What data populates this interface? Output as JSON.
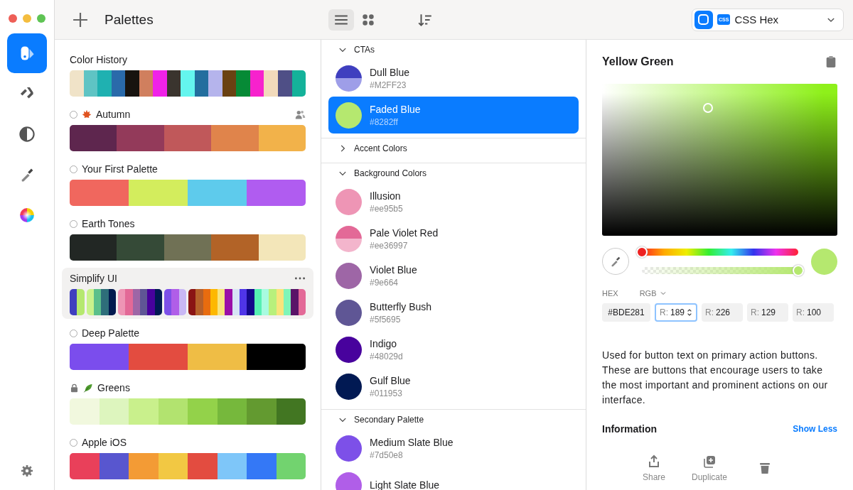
{
  "sidebar": {
    "items": [
      {
        "kind": "palettes",
        "selected": true
      },
      {
        "kind": "tools",
        "selected": false
      },
      {
        "kind": "contrast",
        "selected": false
      },
      {
        "kind": "picker",
        "selected": false
      },
      {
        "kind": "wheel",
        "selected": false
      }
    ]
  },
  "toolbar": {
    "title": "Palettes",
    "views": [
      {
        "kind": "list",
        "selected": true
      },
      {
        "kind": "grid",
        "selected": false
      }
    ],
    "format": {
      "badge": "CSS",
      "label": "CSS Hex"
    }
  },
  "palettes": [
    {
      "name": "Color History",
      "kind": "history",
      "selected": false,
      "shared": false,
      "groups": [
        [
          {
            "color": "#f0e3c8"
          },
          {
            "color": "#5fc4c4"
          },
          {
            "color": "#1fb1b1"
          },
          {
            "color": "#2a6aaa"
          },
          {
            "color": "#17130f"
          },
          {
            "color": "#d07f5e"
          },
          {
            "color": "#f022e8"
          },
          {
            "color": "#3a342e"
          },
          {
            "color": "#64f5ee"
          },
          {
            "color": "#236e9e"
          },
          {
            "color": "#b5b4ec"
          },
          {
            "color": "#6a4112"
          },
          {
            "color": "#068a36"
          },
          {
            "color": "#f722cd"
          },
          {
            "color": "#f2dabb"
          },
          {
            "color": "#4f4f86"
          },
          {
            "color": "#14b29a"
          }
        ]
      ]
    },
    {
      "name": "Autumn",
      "kind": "seasonal",
      "selected": false,
      "shared": true,
      "groups": [
        [
          {
            "color": "#5e264e"
          },
          {
            "color": "#933a5a"
          },
          {
            "color": "#c0585a"
          },
          {
            "color": "#e0844b"
          },
          {
            "color": "#f2b24a"
          }
        ]
      ]
    },
    {
      "name": "Your First Palette",
      "kind": "radio",
      "selected": false,
      "shared": false,
      "groups": [
        [
          {
            "color": "#f0675e"
          },
          {
            "color": "#d3ed5d"
          },
          {
            "color": "#5ecbec"
          },
          {
            "color": "#b05cf0"
          }
        ]
      ]
    },
    {
      "name": "Earth Tones",
      "kind": "radio",
      "selected": false,
      "shared": false,
      "groups": [
        [
          {
            "color": "#222724"
          },
          {
            "color": "#354a37"
          },
          {
            "color": "#707155"
          },
          {
            "color": "#b26327"
          },
          {
            "color": "#f3e6b9"
          }
        ]
      ]
    },
    {
      "name": "Simplify UI",
      "kind": "group",
      "selected": true,
      "shared": false,
      "groups": [
        [
          {
            "color": "#3f3fbf"
          },
          {
            "color": "#b5e86f"
          }
        ],
        [
          {
            "color": "#c9f28c"
          },
          {
            "color": "#5bbf8b"
          },
          {
            "color": "#2e6e7a"
          },
          {
            "color": "#031a4f"
          }
        ],
        [
          {
            "color": "#ee95b5"
          },
          {
            "color": "#e36997"
          },
          {
            "color": "#9e66a6"
          },
          {
            "color": "#5f5695"
          },
          {
            "color": "#48029d"
          },
          {
            "color": "#011953"
          }
        ],
        [
          {
            "color": "#7d50e8"
          },
          {
            "color": "#b05ee8"
          },
          {
            "color": "#c9b8f5"
          }
        ],
        [
          {
            "color": "#8a1414"
          },
          {
            "color": "#b5602a"
          },
          {
            "color": "#e86c0f"
          },
          {
            "color": "#fdb800"
          },
          {
            "color": "#f8e47c"
          },
          {
            "color": "#9a0fa8"
          },
          {
            "color": "#d6e4f5"
          },
          {
            "color": "#4f35e8"
          },
          {
            "color": "#14078a"
          },
          {
            "color": "#56f0b2"
          },
          {
            "color": "#a8fbe0"
          },
          {
            "color": "#b8f07c"
          },
          {
            "color": "#f8e47c"
          },
          {
            "color": "#7ff5b8"
          },
          {
            "color": "#5a1468"
          },
          {
            "color": "#e36997"
          }
        ]
      ]
    },
    {
      "name": "Deep Palette",
      "kind": "radio",
      "selected": false,
      "shared": false,
      "groups": [
        [
          {
            "color": "#7b4ded"
          },
          {
            "color": "#e34c40"
          },
          {
            "color": "#efbd45"
          },
          {
            "color": "#000000"
          }
        ]
      ]
    },
    {
      "name": "Greens",
      "kind": "locked",
      "selected": false,
      "shared": false,
      "groups": [
        [
          {
            "color": "#f1f8de"
          },
          {
            "color": "#ddf5be"
          },
          {
            "color": "#c9f08c"
          },
          {
            "color": "#b2e36f"
          },
          {
            "color": "#93d24a"
          },
          {
            "color": "#76b83c"
          },
          {
            "color": "#639a30"
          },
          {
            "color": "#427622"
          }
        ]
      ]
    },
    {
      "name": "Apple iOS",
      "kind": "radio",
      "selected": false,
      "shared": false,
      "groups": [
        [
          {
            "color": "#e9405a"
          },
          {
            "color": "#5856cf"
          },
          {
            "color": "#f39b35"
          },
          {
            "color": "#f2c843"
          },
          {
            "color": "#e34c40"
          },
          {
            "color": "#7ec6f9"
          },
          {
            "color": "#3478f6"
          },
          {
            "color": "#72d36f"
          }
        ]
      ]
    }
  ],
  "sections": [
    {
      "title": "CTAs",
      "expanded": true,
      "colors": [
        {
          "name": "Dull Blue",
          "hex": "#M2FF23",
          "swatch": [
            {
              "color": "#3f3fbf"
            },
            {
              "color": "#9e9ee8"
            }
          ],
          "selected": false
        },
        {
          "name": "Faded Blue",
          "hex": "#8282ff",
          "swatch": [
            {
              "color": "#b5e86f"
            }
          ],
          "selected": true
        }
      ]
    },
    {
      "title": "Accent Colors",
      "expanded": false
    },
    {
      "title": "Background Colors",
      "expanded": true,
      "colors": [
        {
          "name": "Illusion",
          "hex": "#ee95b5",
          "swatch": [
            {
              "color": "#ee95b5"
            }
          ],
          "selected": false
        },
        {
          "name": "Pale Violet Red",
          "hex": "#ee36997",
          "swatch": [
            {
              "color": "#e36997"
            },
            {
              "color": "#f3b5cc"
            }
          ],
          "selected": false
        },
        {
          "name": "Violet Blue",
          "hex": "#9e664",
          "swatch": [
            {
              "color": "#9e66a6"
            }
          ],
          "selected": false
        },
        {
          "name": "Butterfly Bush",
          "hex": "#5f5695",
          "swatch": [
            {
              "color": "#5f5695"
            }
          ],
          "selected": false
        },
        {
          "name": "Indigo",
          "hex": "#48029d",
          "swatch": [
            {
              "color": "#48029d"
            }
          ],
          "selected": false
        },
        {
          "name": "Gulf Blue",
          "hex": "#011953",
          "swatch": [
            {
              "color": "#011953"
            }
          ],
          "selected": false
        }
      ]
    },
    {
      "title": "Secondary Palette",
      "expanded": true,
      "colors": [
        {
          "name": "Medium Slate Blue",
          "hex": "#7d50e8",
          "swatch": [
            {
              "color": "#7d50e8"
            }
          ],
          "selected": false
        },
        {
          "name": "Light Slate Blue",
          "swatch": [
            {
              "color": "#b05ee8"
            }
          ],
          "selected": false
        }
      ]
    }
  ],
  "detail": {
    "title": "Yellow Green",
    "picker": {
      "color": "#8ef01a"
    },
    "hue": {
      "level": 0
    },
    "alpha": {
      "level": 1
    },
    "preview": {
      "color": "#b5e86f"
    },
    "hex_label": "HEX",
    "mode_label": "RGB",
    "fields": [
      {
        "kind": "hex",
        "value": "#BDE281",
        "focused": false
      },
      {
        "kind": "channel",
        "prefix": "R:",
        "value": "189",
        "focused": true
      },
      {
        "kind": "channel",
        "prefix": "R:",
        "value": "226",
        "focused": false
      },
      {
        "kind": "channel",
        "prefix": "R:",
        "value": "129",
        "focused": false
      },
      {
        "kind": "channel",
        "prefix": "R:",
        "value": "100",
        "focused": false
      }
    ],
    "description": "Used for button text on primary action buttons. These are buttons that encourage users to take the most important and prominent actions on our interface.",
    "info_title": "Information",
    "info_link": "Show Less",
    "actions": [
      {
        "kind": "share",
        "label": "Share"
      },
      {
        "kind": "duplicate",
        "label": "Duplicate"
      },
      {
        "kind": "delete"
      }
    ]
  }
}
